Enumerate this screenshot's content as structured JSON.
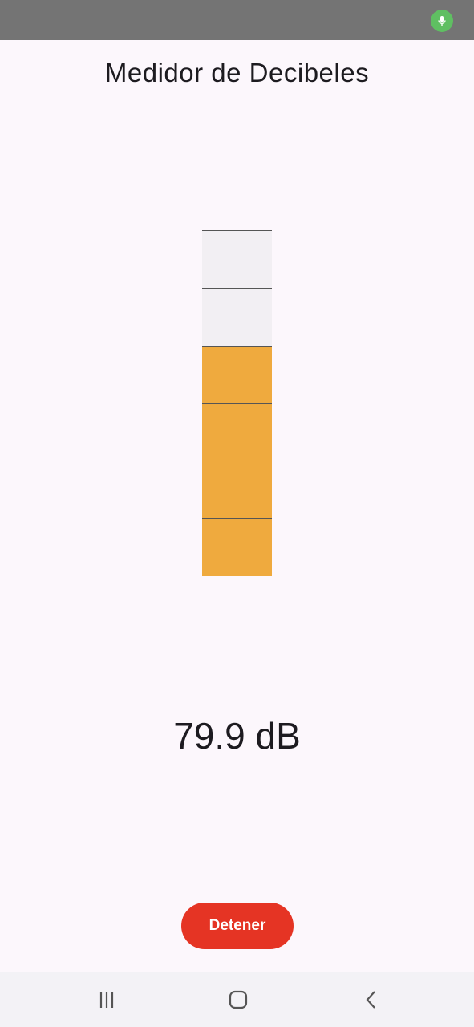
{
  "status_bar": {
    "mic_icon": "microphone-icon",
    "mic_color": "#5fbf62"
  },
  "app": {
    "title": "Medidor de Decibeles"
  },
  "meter": {
    "level": 0.667,
    "segments": 6,
    "filled_segments": 4,
    "fill_color": "#efaa3e",
    "empty_color": "#f2eff3"
  },
  "reading": {
    "value_label": "79.9 dB"
  },
  "actions": {
    "stop_label": "Detener",
    "stop_color": "#e53424"
  },
  "nav": {
    "recents_icon": "recent-apps-icon",
    "home_icon": "home-icon",
    "back_icon": "back-icon"
  }
}
